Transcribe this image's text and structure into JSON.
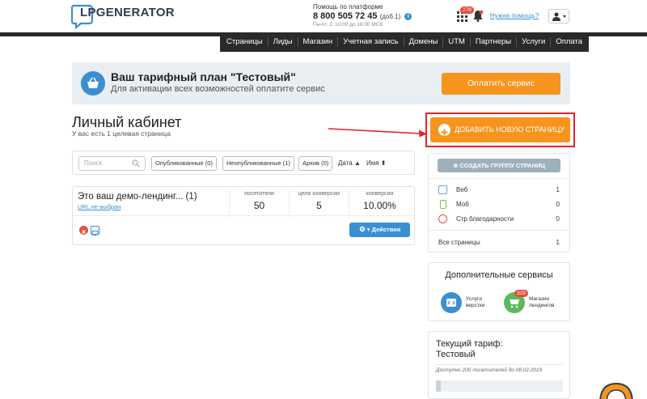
{
  "header": {
    "logo_text": "LPGENERATOR",
    "help_title": "Помощь по платформе",
    "help_phone": "8 800 505 72 45",
    "help_ext": "(доб.1)",
    "help_hours": "Пн-пт: С 10:00 до 18:00 МСК",
    "apps_badge": "278",
    "need_help": "Нужна помощь?"
  },
  "nav": {
    "items": [
      "Страницы",
      "Лиды",
      "Магазин",
      "Учетная запись",
      "Домены",
      "UTM",
      "Партнеры",
      "Услуги",
      "Оплата"
    ]
  },
  "banner": {
    "title": "Ваш тарифный план \"Тестовый\"",
    "subtitle": "Для активации всех возможностей оплатите сервис",
    "pay_label": "Оплатить сервис"
  },
  "cabinet": {
    "title": "Личный кабинет",
    "subtitle": "У вас есть 1 целевая страница",
    "add_page_label": "ДОБАВИТЬ НОВУЮ СТРАНИЦУ"
  },
  "filters": {
    "search_placeholder": "Поиск",
    "published": "Опубликованные (0)",
    "unpublished": "Неопубликованные (1)",
    "archive": "Архив (0)",
    "sort_date": "Дата ▲",
    "sort_name": "Имя ⬍"
  },
  "page_card": {
    "name": "Это ваш демо-лендинг... (1)",
    "url": "URL не выбран",
    "stats": [
      {
        "label": "посетители",
        "value": "50"
      },
      {
        "label": "цели конверсии",
        "value": "5"
      },
      {
        "label": "конверсия",
        "value": "10.00%"
      }
    ],
    "actions_label": "▾ Действия"
  },
  "pages_panel": {
    "group_label": "СОЗДАТЬ ГРУППУ СТРАНИЦ",
    "rows": [
      {
        "label": "Веб",
        "value": "1"
      },
      {
        "label": "Моб",
        "value": "0"
      },
      {
        "label": "Стр благодарности",
        "value": "0"
      }
    ],
    "total_label": "Все страницы",
    "total_value": "1"
  },
  "services": {
    "title": "Дополнительные сервисы",
    "layout_line1": "Услуги",
    "layout_line2": "верстки",
    "shop_line1": "Магазин",
    "shop_line2": "лендингов",
    "shop_badge": "329"
  },
  "tariff": {
    "title_line1": "Текущий тариф:",
    "title_line2": "Тестовый",
    "available": "Доступно 200 посетителей до 08.02.2019",
    "progress_fraction": 0.04
  },
  "colors": {
    "accent_orange": "#f7941d",
    "accent_blue": "#3a8fd1",
    "nav_dark": "#2a2a2a",
    "highlight_red": "#e0242a"
  }
}
